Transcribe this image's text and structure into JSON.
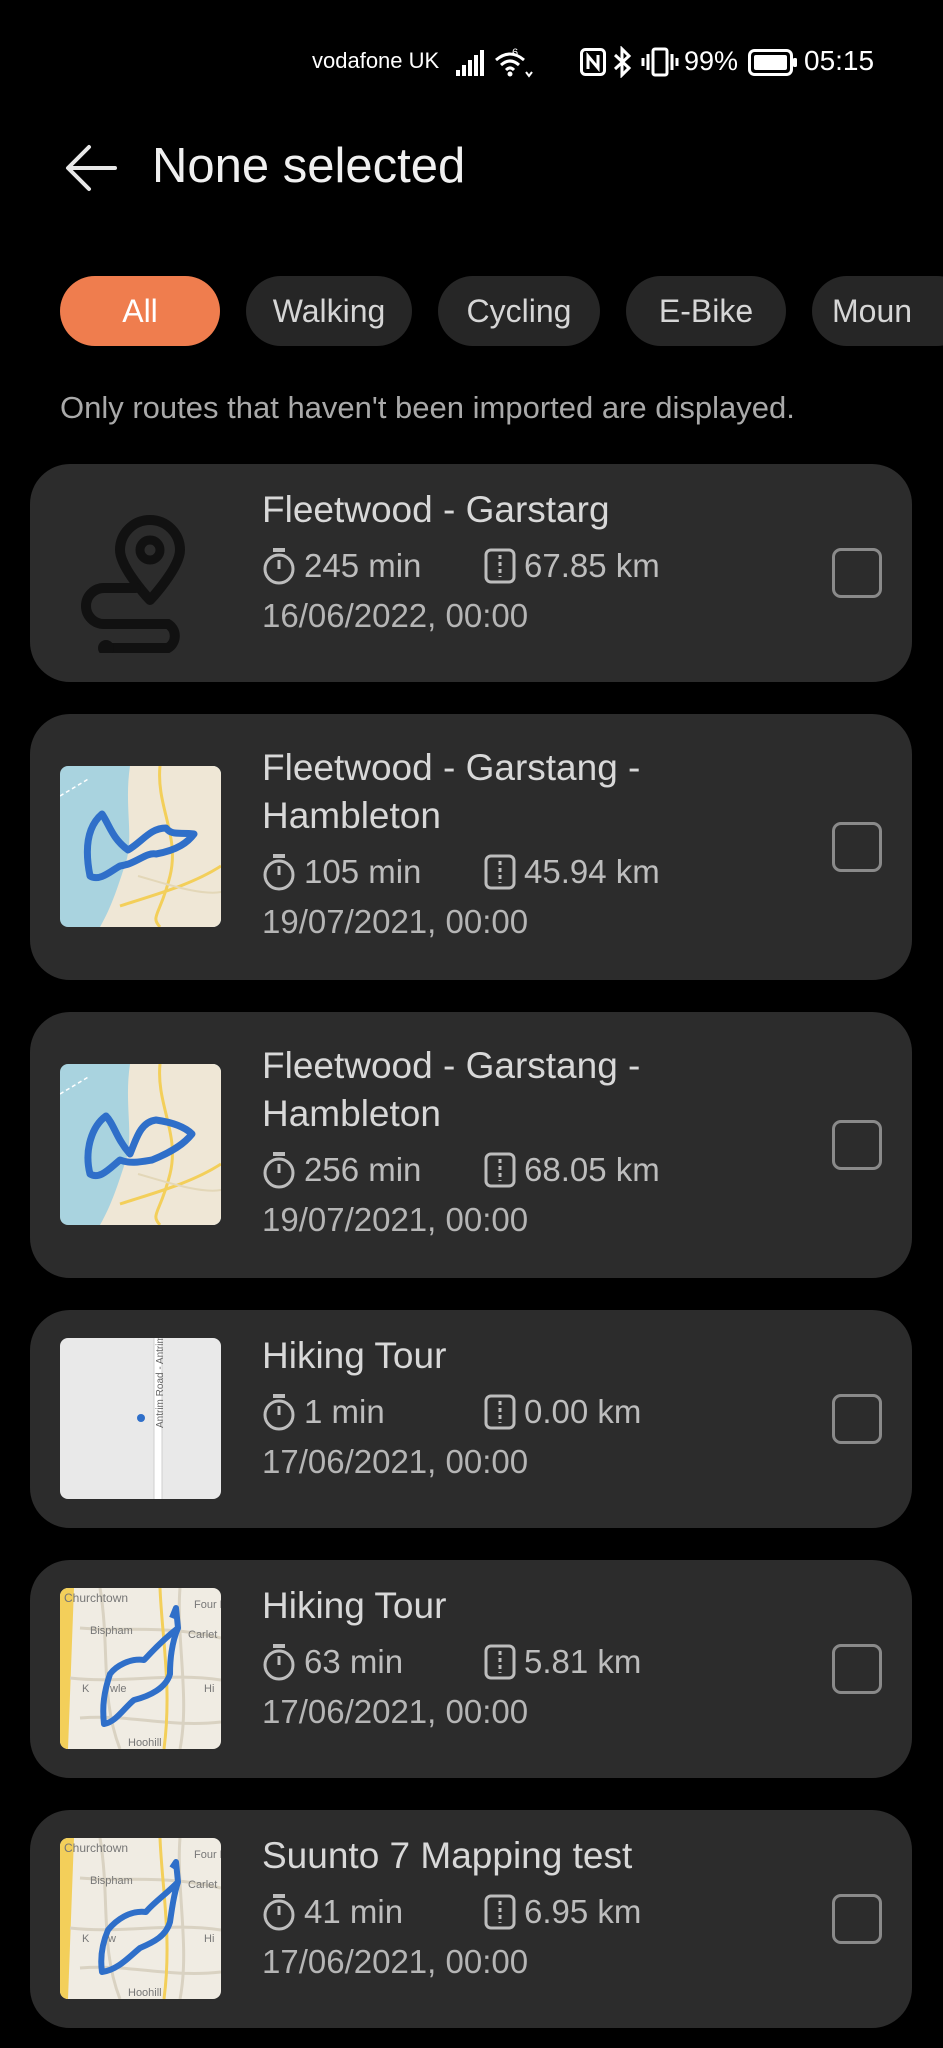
{
  "status_bar": {
    "carrier": "vodafone UK",
    "network": "6",
    "battery_percent": "99%",
    "time": "05:15"
  },
  "header": {
    "title": "None selected"
  },
  "filters": [
    {
      "label": "All",
      "active": true
    },
    {
      "label": "Walking",
      "active": false
    },
    {
      "label": "Cycling",
      "active": false
    },
    {
      "label": "E-Bike",
      "active": false
    },
    {
      "label": "Moun",
      "active": false
    }
  ],
  "note": "Only routes that haven't been imported are displayed.",
  "routes": [
    {
      "title_lines": [
        "Fleetwood - Garstarg"
      ],
      "duration": "245 min",
      "distance": "67.85 km",
      "date": "16/06/2022, 00:00",
      "thumbnail": "route-placeholder-icon",
      "checked": false
    },
    {
      "title_lines": [
        "Fleetwood - Garstang -",
        "Hambleton"
      ],
      "duration": "105 min",
      "distance": "45.94 km",
      "date": "19/07/2021, 00:00",
      "thumbnail": "map-coast",
      "checked": false
    },
    {
      "title_lines": [
        "Fleetwood - Garstang -",
        "Hambleton"
      ],
      "duration": "256 min",
      "distance": "68.05 km",
      "date": "19/07/2021, 00:00",
      "thumbnail": "map-coast",
      "checked": false
    },
    {
      "title_lines": [
        "Hiking Tour"
      ],
      "duration": "1 min",
      "distance": "0.00 km",
      "date": "17/06/2021, 00:00",
      "thumbnail": "map-road",
      "map_label": "Antrim Road - Antrim",
      "checked": false
    },
    {
      "title_lines": [
        "Hiking Tour"
      ],
      "duration": "63 min",
      "distance": "5.81 km",
      "date": "17/06/2021, 00:00",
      "thumbnail": "map-town",
      "map_labels": [
        "Churchtown",
        "Bispham",
        "Four L",
        "Carlet",
        "K",
        "wle",
        "Hi",
        "Hoohill"
      ],
      "checked": false
    },
    {
      "title_lines": [
        "Suunto 7 Mapping test"
      ],
      "duration": "41 min",
      "distance": "6.95 km",
      "date": "17/06/2021, 00:00",
      "thumbnail": "map-town",
      "map_labels": [
        "Churchtown",
        "Bispham",
        "Four L",
        "Carlet",
        "K",
        "w",
        "Hi",
        "Hoohill"
      ],
      "checked": false
    }
  ],
  "colors": {
    "accent": "#ef7d4e",
    "card_bg": "#2c2c2c",
    "route_line": "#2f6fc9"
  }
}
